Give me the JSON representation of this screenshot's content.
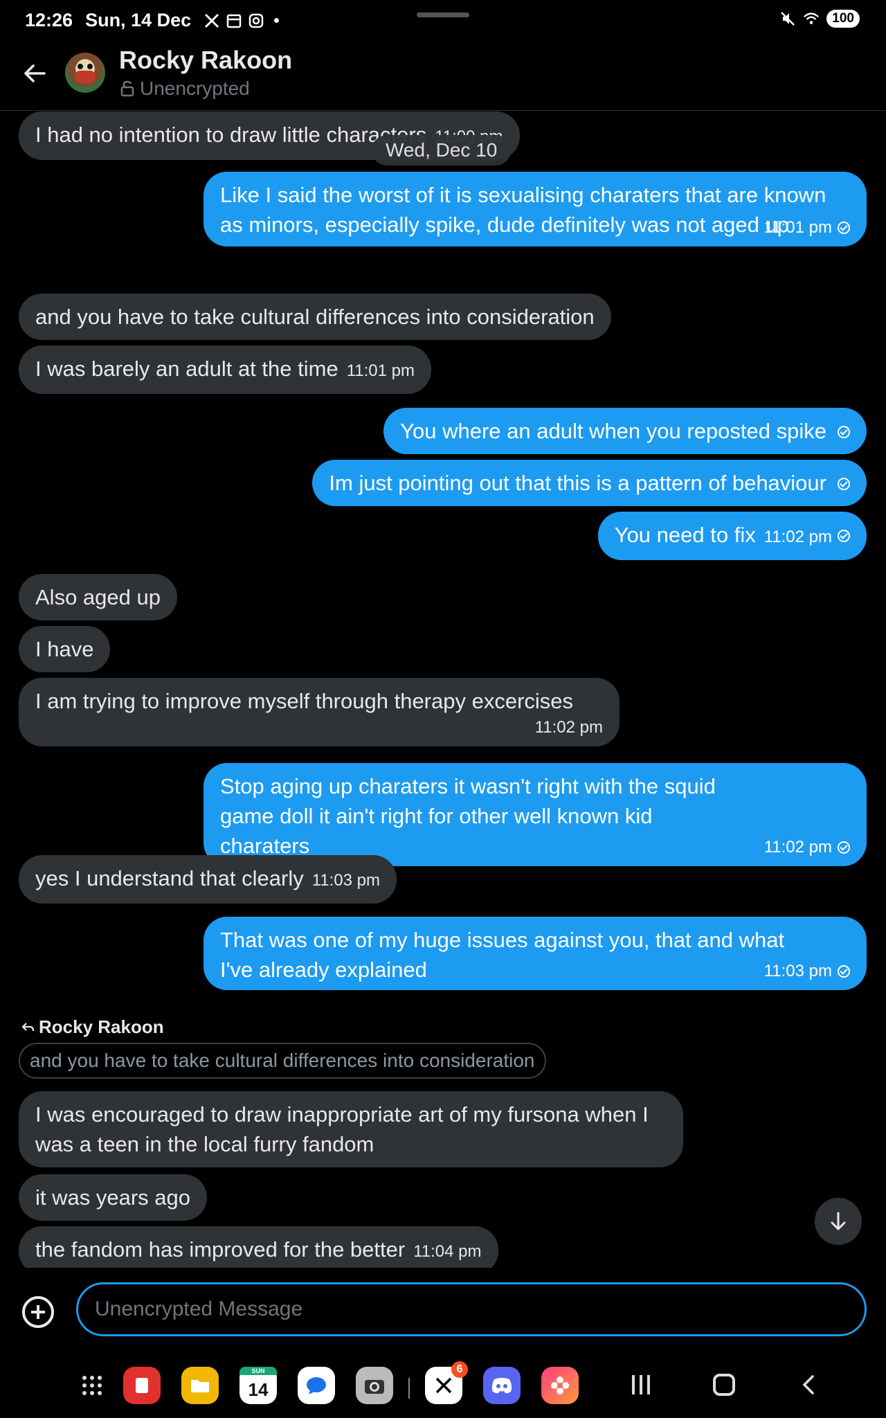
{
  "status_bar": {
    "time": "12:26",
    "date": "Sun, 14 Dec",
    "battery": "100",
    "icons": [
      "x-icon",
      "calendar-icon",
      "instagram-icon",
      "mute-icon",
      "wifi-icon"
    ]
  },
  "header": {
    "name": "Rocky Rakoon",
    "encryption": "Unencrypted"
  },
  "date_divider": "Wed, Dec 10",
  "messages": [
    {
      "side": "in",
      "text": "I had no intention to draw little characters",
      "time": "11:00 pm"
    },
    {
      "side": "out",
      "text": "Like I said the worst of it is sexualising charaters that are known as minors, especially spike, dude definitely was not aged up",
      "time": "11:01 pm"
    },
    {
      "side": "in",
      "text": "and you have to take cultural differences into consideration"
    },
    {
      "side": "in",
      "text": "I was barely an adult at the time",
      "time": "11:01 pm"
    },
    {
      "side": "out",
      "text": "You where an adult when you reposted spike"
    },
    {
      "side": "out",
      "text": "Im just pointing out that this is a pattern of behaviour"
    },
    {
      "side": "out",
      "text": "You need to fix",
      "time": "11:02 pm"
    },
    {
      "side": "in",
      "text": "Also aged up"
    },
    {
      "side": "in",
      "text": "I have"
    },
    {
      "side": "in",
      "text": "I am trying to improve myself through therapy excercises",
      "time": "11:02 pm"
    },
    {
      "side": "out",
      "text": "Stop aging up charaters it wasn't right with the squid game doll it ain't right for other well known kid charaters",
      "time": "11:02 pm"
    },
    {
      "side": "in",
      "text": "yes I understand that clearly",
      "time": "11:03 pm"
    },
    {
      "side": "out",
      "text": "That was one of my huge issues against you, that and what I've already explained",
      "time": "11:03 pm"
    },
    {
      "side": "in",
      "text": "I was encouraged to draw inappropriate art of my fursona when I was a teen in the local furry fandom"
    },
    {
      "side": "in",
      "text": "it was years ago"
    },
    {
      "side": "in",
      "text": "the fandom has improved for the better",
      "time": "11:04 pm"
    }
  ],
  "reply": {
    "author": "Rocky Rakoon",
    "quoted_text": "and you have to take cultural differences into consideration"
  },
  "composer": {
    "placeholder": "Unencrypted Message"
  },
  "navbar": {
    "calendar_day_label": "SUN",
    "calendar_day": "14",
    "x_badge": "6",
    "apps": [
      "apps-grid-icon",
      "notes-app-icon",
      "files-app-icon",
      "calendar-app-icon",
      "messages-app-icon",
      "camera-app-icon",
      "x-app-icon",
      "discord-app-icon",
      "gallery-app-icon"
    ]
  },
  "colors": {
    "outgoing_bubble": "#1d9bf0",
    "incoming_bubble": "#2f3336",
    "background": "#000000"
  }
}
